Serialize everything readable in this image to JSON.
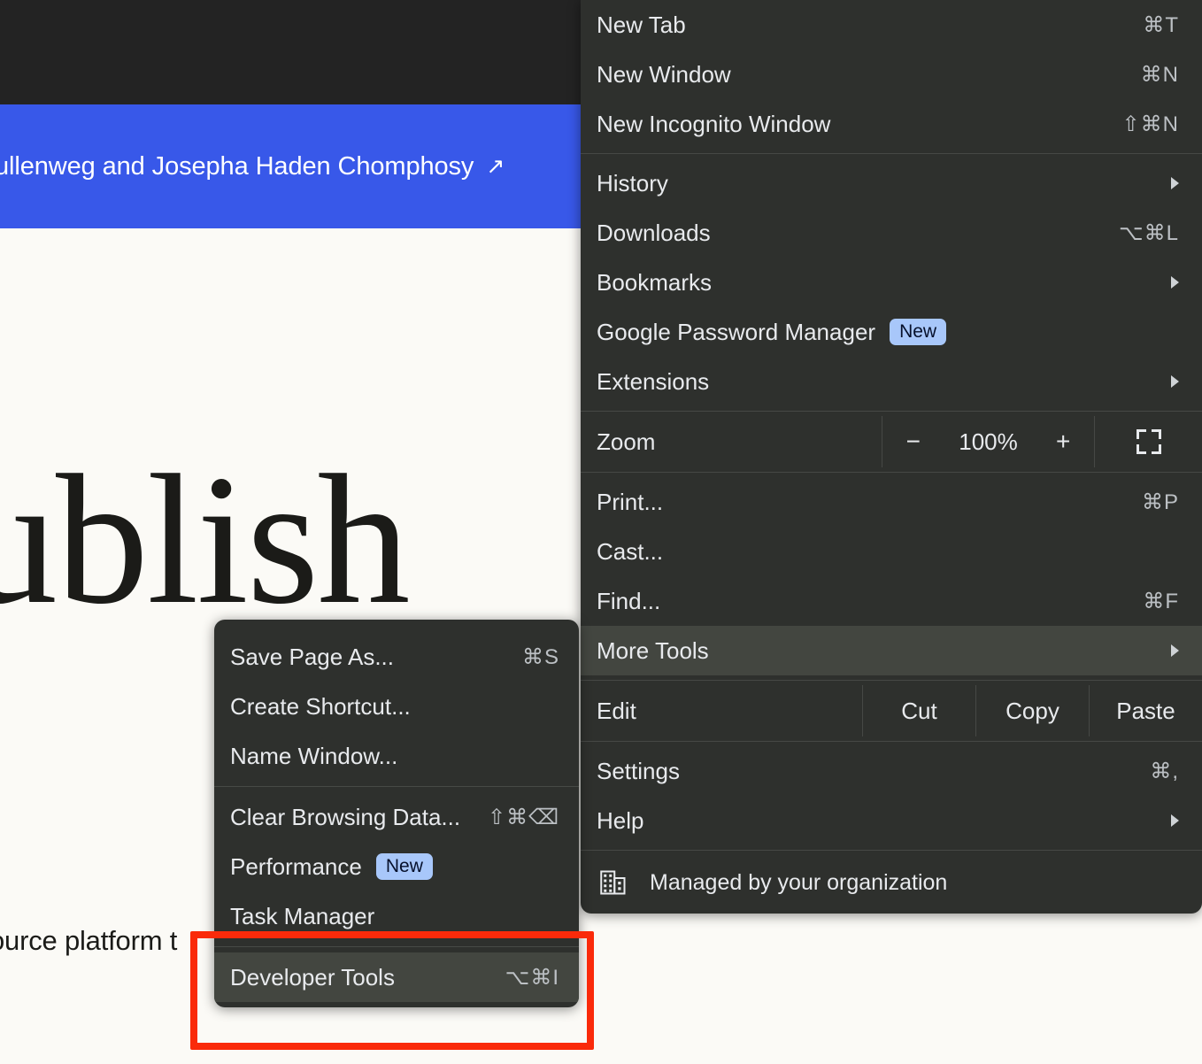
{
  "page": {
    "banner_text": "ullenweg and Josepha Haden Chomphosy",
    "banner_arrow": "↗",
    "hero_text": "ublish",
    "sub_text": "ource platform t",
    "banner_color": "#3858e9",
    "header_color": "#232323",
    "background_color": "#fbfaf6"
  },
  "main_menu": {
    "items": {
      "new_tab": {
        "label": "New Tab",
        "accel": "⌘T"
      },
      "new_window": {
        "label": "New Window",
        "accel": "⌘N"
      },
      "new_incognito": {
        "label": "New Incognito Window",
        "accel": "⇧⌘N"
      },
      "history": {
        "label": "History"
      },
      "downloads": {
        "label": "Downloads",
        "accel": "⌥⌘L"
      },
      "bookmarks": {
        "label": "Bookmarks"
      },
      "password_manager": {
        "label": "Google Password Manager",
        "badge": "New"
      },
      "extensions": {
        "label": "Extensions"
      },
      "zoom": {
        "label": "Zoom",
        "minus": "−",
        "value": "100%",
        "plus": "+",
        "fullscreen_icon": "fullscreen-icon"
      },
      "print": {
        "label": "Print...",
        "accel": "⌘P"
      },
      "cast": {
        "label": "Cast..."
      },
      "find": {
        "label": "Find...",
        "accel": "⌘F"
      },
      "more_tools": {
        "label": "More Tools"
      },
      "edit": {
        "label": "Edit",
        "cut": "Cut",
        "copy": "Copy",
        "paste": "Paste"
      },
      "settings": {
        "label": "Settings",
        "accel": "⌘,"
      },
      "help": {
        "label": "Help"
      },
      "managed": {
        "label": "Managed by your organization",
        "icon": "building-icon"
      }
    },
    "badge_color": "#a8c7fa",
    "background_color": "#2e302d",
    "hover_color": "#434640"
  },
  "sub_menu": {
    "items": {
      "save_page_as": {
        "label": "Save Page As...",
        "accel": "⌘S"
      },
      "create_shortcut": {
        "label": "Create Shortcut..."
      },
      "name_window": {
        "label": "Name Window..."
      },
      "clear_browsing_data": {
        "label": "Clear Browsing Data...",
        "accel": "⇧⌘⌫"
      },
      "performance": {
        "label": "Performance",
        "badge": "New"
      },
      "task_manager": {
        "label": "Task Manager"
      },
      "developer_tools": {
        "label": "Developer Tools",
        "accel": "⌥⌘I"
      }
    }
  },
  "annotation": {
    "color": "#fa2a0a",
    "target": "Developer Tools"
  }
}
